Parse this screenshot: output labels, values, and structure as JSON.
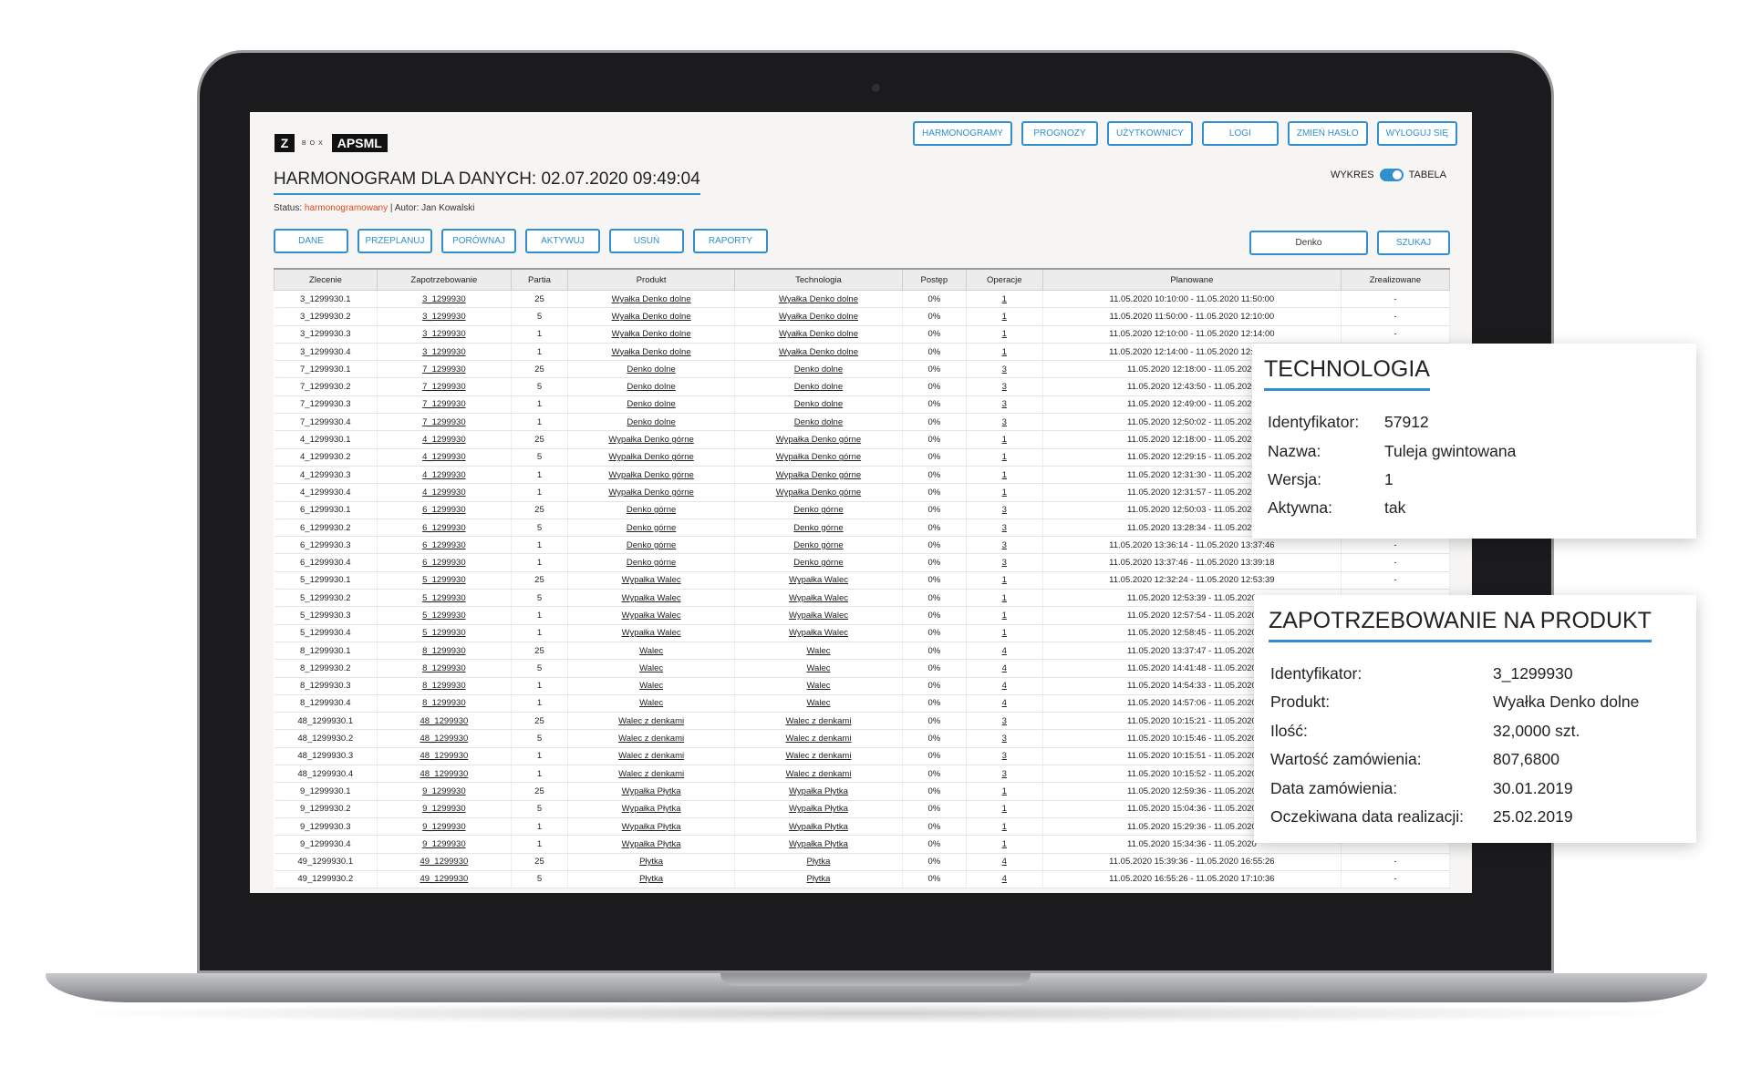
{
  "brand": {
    "z": "Z",
    "box": "BOX",
    "name": "APSML"
  },
  "nav": [
    "HARMONOGRAMY",
    "PROGNOZY",
    "UŻYTKOWNICY",
    "LOGI",
    "ZMIEŃ HASŁO",
    "WYLOGUJ SIĘ"
  ],
  "page_title": "HARMONOGRAM DLA DANYCH: 02.07.2020 09:49:04",
  "view_toggle": {
    "left": "WYKRES",
    "right": "TABELA"
  },
  "status": {
    "label": "Status:",
    "value": "harmonogramowany",
    "separator": " | ",
    "author_label": "Autor:",
    "author": "Jan Kowalski"
  },
  "actions": [
    "DANE",
    "PRZEPLANUJ",
    "PORÓWNAJ",
    "AKTYWUJ",
    "USUŃ",
    "RAPORTY"
  ],
  "search": {
    "value": "Denko",
    "button": "SZUKAJ"
  },
  "table": {
    "columns": [
      "Zlecenie",
      "Zapotrzebowanie",
      "Partia",
      "Produkt",
      "Technologia",
      "Postęp",
      "Operacje",
      "Planowane",
      "Zrealizowane"
    ],
    "rows": [
      [
        "3_1299930.1",
        "3_1299930",
        "25",
        "Wyałka Denko dolne",
        "Wyałka Denko dolne",
        "0%",
        "1",
        "11.05.2020 10:10:00 - 11.05.2020 11:50:00",
        "-"
      ],
      [
        "3_1299930.2",
        "3_1299930",
        "5",
        "Wyałka Denko dolne",
        "Wyałka Denko dolne",
        "0%",
        "1",
        "11.05.2020 11:50:00 - 11.05.2020 12:10:00",
        "-"
      ],
      [
        "3_1299930.3",
        "3_1299930",
        "1",
        "Wyałka Denko dolne",
        "Wyałka Denko dolne",
        "0%",
        "1",
        "11.05.2020 12:10:00 - 11.05.2020 12:14:00",
        "-"
      ],
      [
        "3_1299930.4",
        "3_1299930",
        "1",
        "Wyałka Denko dolne",
        "Wyałka Denko dolne",
        "0%",
        "1",
        "11.05.2020 12:14:00 - 11.05.2020 12:18:00",
        ""
      ],
      [
        "7_1299930.1",
        "7_1299930",
        "25",
        "Denko dolne",
        "Denko dolne",
        "0%",
        "3",
        "11.05.2020 12:18:00 - 11.05.2020",
        ""
      ],
      [
        "7_1299930.2",
        "7_1299930",
        "5",
        "Denko dolne",
        "Denko dolne",
        "0%",
        "3",
        "11.05.2020 12:43:50 - 11.05.2020",
        ""
      ],
      [
        "7_1299930.3",
        "7_1299930",
        "1",
        "Denko dolne",
        "Denko dolne",
        "0%",
        "3",
        "11.05.2020 12:49:00 - 11.05.2020",
        ""
      ],
      [
        "7_1299930.4",
        "7_1299930",
        "1",
        "Denko dolne",
        "Denko dolne",
        "0%",
        "3",
        "11.05.2020 12:50:02 - 11.05.2020",
        ""
      ],
      [
        "4_1299930.1",
        "4_1299930",
        "25",
        "Wypałka Denko górne",
        "Wypałka Denko górne",
        "0%",
        "1",
        "11.05.2020 12:18:00 - 11.05.2020",
        ""
      ],
      [
        "4_1299930.2",
        "4_1299930",
        "5",
        "Wypałka Denko górne",
        "Wypałka Denko górne",
        "0%",
        "1",
        "11.05.2020 12:29:15 - 11.05.2020",
        ""
      ],
      [
        "4_1299930.3",
        "4_1299930",
        "1",
        "Wypałka Denko górne",
        "Wypałka Denko górne",
        "0%",
        "1",
        "11.05.2020 12:31:30 - 11.05.2020",
        ""
      ],
      [
        "4_1299930.4",
        "4_1299930",
        "1",
        "Wypałka Denko górne",
        "Wypałka Denko górne",
        "0%",
        "1",
        "11.05.2020 12:31:57 - 11.05.2020",
        ""
      ],
      [
        "6_1299930.1",
        "6_1299930",
        "25",
        "Denko górne",
        "Denko górne",
        "0%",
        "3",
        "11.05.2020 12:50:03 - 11.05.2020",
        ""
      ],
      [
        "6_1299930.2",
        "6_1299930",
        "5",
        "Denko górne",
        "Denko górne",
        "0%",
        "3",
        "11.05.2020 13:28:34 - 11.05.2020",
        ""
      ],
      [
        "6_1299930.3",
        "6_1299930",
        "1",
        "Denko górne",
        "Denko górne",
        "0%",
        "3",
        "11.05.2020 13:36:14 - 11.05.2020 13:37:46",
        "-"
      ],
      [
        "6_1299930.4",
        "6_1299930",
        "1",
        "Denko górne",
        "Denko górne",
        "0%",
        "3",
        "11.05.2020 13:37:46 - 11.05.2020 13:39:18",
        "-"
      ],
      [
        "5_1299930.1",
        "5_1299930",
        "25",
        "Wypałka Walec",
        "Wypałka Walec",
        "0%",
        "1",
        "11.05.2020 12:32:24 - 11.05.2020 12:53:39",
        "-"
      ],
      [
        "5_1299930.2",
        "5_1299930",
        "5",
        "Wypałka Walec",
        "Wypałka Walec",
        "0%",
        "1",
        "11.05.2020 12:53:39 - 11.05.2020",
        ""
      ],
      [
        "5_1299930.3",
        "5_1299930",
        "1",
        "Wypałka Walec",
        "Wypałka Walec",
        "0%",
        "1",
        "11.05.2020 12:57:54 - 11.05.2020",
        ""
      ],
      [
        "5_1299930.4",
        "5_1299930",
        "1",
        "Wypałka Walec",
        "Wypałka Walec",
        "0%",
        "1",
        "11.05.2020 12:58:45 - 11.05.2020",
        ""
      ],
      [
        "8_1299930.1",
        "8_1299930",
        "25",
        "Walec",
        "Walec",
        "0%",
        "4",
        "11.05.2020 13:37:47 - 11.05.2020",
        ""
      ],
      [
        "8_1299930.2",
        "8_1299930",
        "5",
        "Walec",
        "Walec",
        "0%",
        "4",
        "11.05.2020 14:41:48 - 11.05.2020",
        ""
      ],
      [
        "8_1299930.3",
        "8_1299930",
        "1",
        "Walec",
        "Walec",
        "0%",
        "4",
        "11.05.2020 14:54:33 - 11.05.2020",
        ""
      ],
      [
        "8_1299930.4",
        "8_1299930",
        "1",
        "Walec",
        "Walec",
        "0%",
        "4",
        "11.05.2020 14:57:06 - 11.05.2020",
        ""
      ],
      [
        "48_1299930.1",
        "48_1299930",
        "25",
        "Walec z denkami",
        "Walec z denkami",
        "0%",
        "3",
        "11.05.2020 10:15:21 - 11.05.2020",
        ""
      ],
      [
        "48_1299930.2",
        "48_1299930",
        "5",
        "Walec z denkami",
        "Walec z denkami",
        "0%",
        "3",
        "11.05.2020 10:15:46 - 11.05.2020",
        ""
      ],
      [
        "48_1299930.3",
        "48_1299930",
        "1",
        "Walec z denkami",
        "Walec z denkami",
        "0%",
        "3",
        "11.05.2020 10:15:51 - 11.05.2020",
        ""
      ],
      [
        "48_1299930.4",
        "48_1299930",
        "1",
        "Walec z denkami",
        "Walec z denkami",
        "0%",
        "3",
        "11.05.2020 10:15:52 - 11.05.2020",
        ""
      ],
      [
        "9_1299930.1",
        "9_1299930",
        "25",
        "Wypałka Płytka",
        "Wypałka Płytka",
        "0%",
        "1",
        "11.05.2020 12:59:36 - 11.05.2020",
        ""
      ],
      [
        "9_1299930.2",
        "9_1299930",
        "5",
        "Wypałka Płytka",
        "Wypałka Płytka",
        "0%",
        "1",
        "11.05.2020 15:04:36 - 11.05.2020",
        ""
      ],
      [
        "9_1299930.3",
        "9_1299930",
        "1",
        "Wypałka Płytka",
        "Wypałka Płytka",
        "0%",
        "1",
        "11.05.2020 15:29:36 - 11.05.2020",
        ""
      ],
      [
        "9_1299930.4",
        "9_1299930",
        "1",
        "Wypałka Płytka",
        "Wypałka Płytka",
        "0%",
        "1",
        "11.05.2020 15:34:36 - 11.05.2020",
        ""
      ],
      [
        "49_1299930.1",
        "49_1299930",
        "25",
        "Płytka",
        "Płytka",
        "0%",
        "4",
        "11.05.2020 15:39:36 - 11.05.2020 16:55:26",
        "-"
      ],
      [
        "49_1299930.2",
        "49_1299930",
        "5",
        "Płytka",
        "Płytka",
        "0%",
        "4",
        "11.05.2020 16:55:26 - 11.05.2020 17:10:36",
        "-"
      ]
    ]
  },
  "technologia": {
    "title": "TECHNOLOGIA",
    "fields": [
      {
        "label": "Identyfikator:",
        "value": "57912"
      },
      {
        "label": "Nazwa:",
        "value": "Tuleja gwintowana"
      },
      {
        "label": "Wersja:",
        "value": "1"
      },
      {
        "label": "Aktywna:",
        "value": "tak"
      }
    ]
  },
  "zapotrzebowanie": {
    "title": "ZAPOTRZEBOWANIE NA PRODUKT",
    "fields": [
      {
        "label": "Identyfikator:",
        "value": "3_1299930"
      },
      {
        "label": "Produkt:",
        "value": "Wyałka Denko dolne"
      },
      {
        "label": "Ilość:",
        "value": "32,0000 szt."
      },
      {
        "label": "Wartość zamówienia:",
        "value": "807,6800"
      },
      {
        "label": "Data zamówienia:",
        "value": "30.01.2019"
      },
      {
        "label": "Oczekiwana data realizacji:",
        "value": "25.02.2019"
      }
    ]
  },
  "colors": {
    "accent": "#2f8fcf",
    "status_highlight": "#e0491f"
  }
}
